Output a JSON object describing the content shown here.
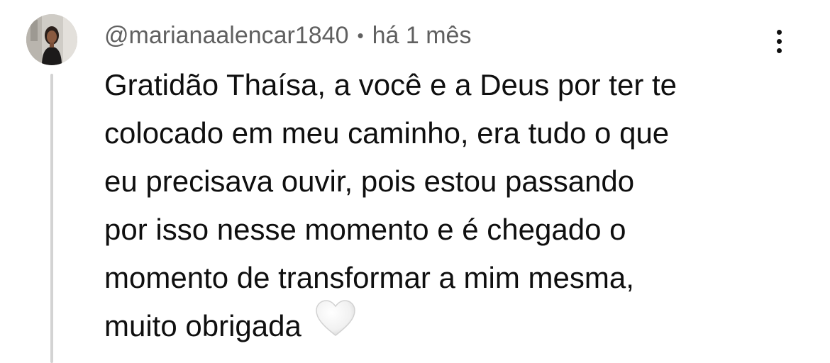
{
  "comment": {
    "author": "@marianaalencar1840",
    "separator": "•",
    "timestamp": "há 1 mês",
    "text_lines": [
      "Gratidão Thaísa, a você e a Deus por ter te",
      "colocado em meu caminho, era tudo o que",
      "eu precisava ouvir, pois estou passando",
      "por isso nesse momento e é chegado o",
      "momento de transformar a mim mesma,",
      "muito obrigada"
    ],
    "emoji": "white-heart-icon",
    "more_actions_icon": "vertical-dots-icon"
  },
  "colors": {
    "text": "#0f0f0f",
    "meta": "#606060",
    "thread_line": "#d3d3d3",
    "heart": "#f2f2f2"
  }
}
